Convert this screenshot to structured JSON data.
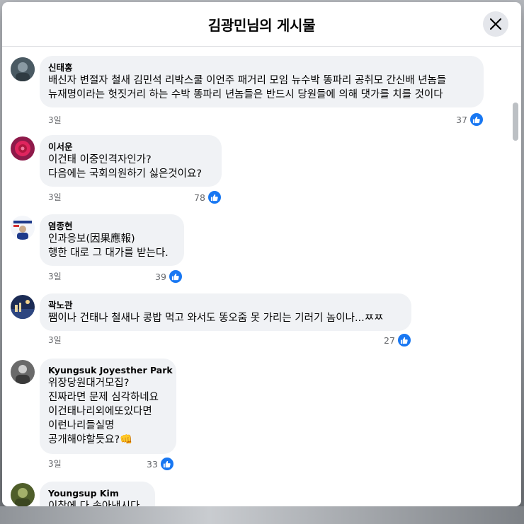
{
  "modal": {
    "title": "김광민님의 게시물",
    "close_icon": "close-icon"
  },
  "comments": [
    {
      "author": "신태홍",
      "lines": [
        "배신자 변절자 철새 김민석 리박스쿨 이언주 패거리 모임 뉴수박 똥파리 공취모 간신배 년놈들",
        "뉴재명이라는 헛짓거리 하는 수박 똥파리 년놈들은 반드시 당원들에 의해 댓가를 치를 것이다"
      ],
      "time": "3일",
      "likes": "37",
      "avatar_color": "#5a6a74"
    },
    {
      "author": "이서운",
      "lines": [
        "이건태 이중인격자인가?",
        "다음에는 국회의원하기 싫은것이요?"
      ],
      "time": "3일",
      "likes": "78",
      "avatar_color": "#c2185b"
    },
    {
      "author": "염종현",
      "lines": [
        "인과응보(因果應報)",
        "행한 대로 그 대가를 받는다."
      ],
      "time": "3일",
      "likes": "39",
      "avatar_color": "#1e3a8a"
    },
    {
      "author": "곽노관",
      "lines": [
        "쨈이나 건태나 철새나 콩밥 먹고 와서도 똥오줌 못 가리는 기러기 놈이나...ㅉㅉ"
      ],
      "time": "3일",
      "likes": "27",
      "avatar_color": "#2a3b66"
    },
    {
      "author": "Kyungsuk Joyesther Park",
      "lines": [
        "위장당원대거모집?",
        "진짜라면 문제 심각하네요",
        "이건태나리외에또있다면",
        "이런나리들실명",
        "공개해야할듯요?👊"
      ],
      "time": "3일",
      "likes": "33",
      "avatar_color": "#555555"
    },
    {
      "author": "Youngsup Kim",
      "lines": [
        "이참에 다 솎아낸시다"
      ],
      "time": "",
      "likes": "",
      "avatar_color": "#6b7a3a"
    }
  ],
  "icons": {
    "like": "thumbs-up-icon",
    "close": "close-icon"
  },
  "colors": {
    "like_blue": "#1877f2",
    "bubble_bg": "#f0f2f5",
    "meta_gray": "#65676b"
  }
}
